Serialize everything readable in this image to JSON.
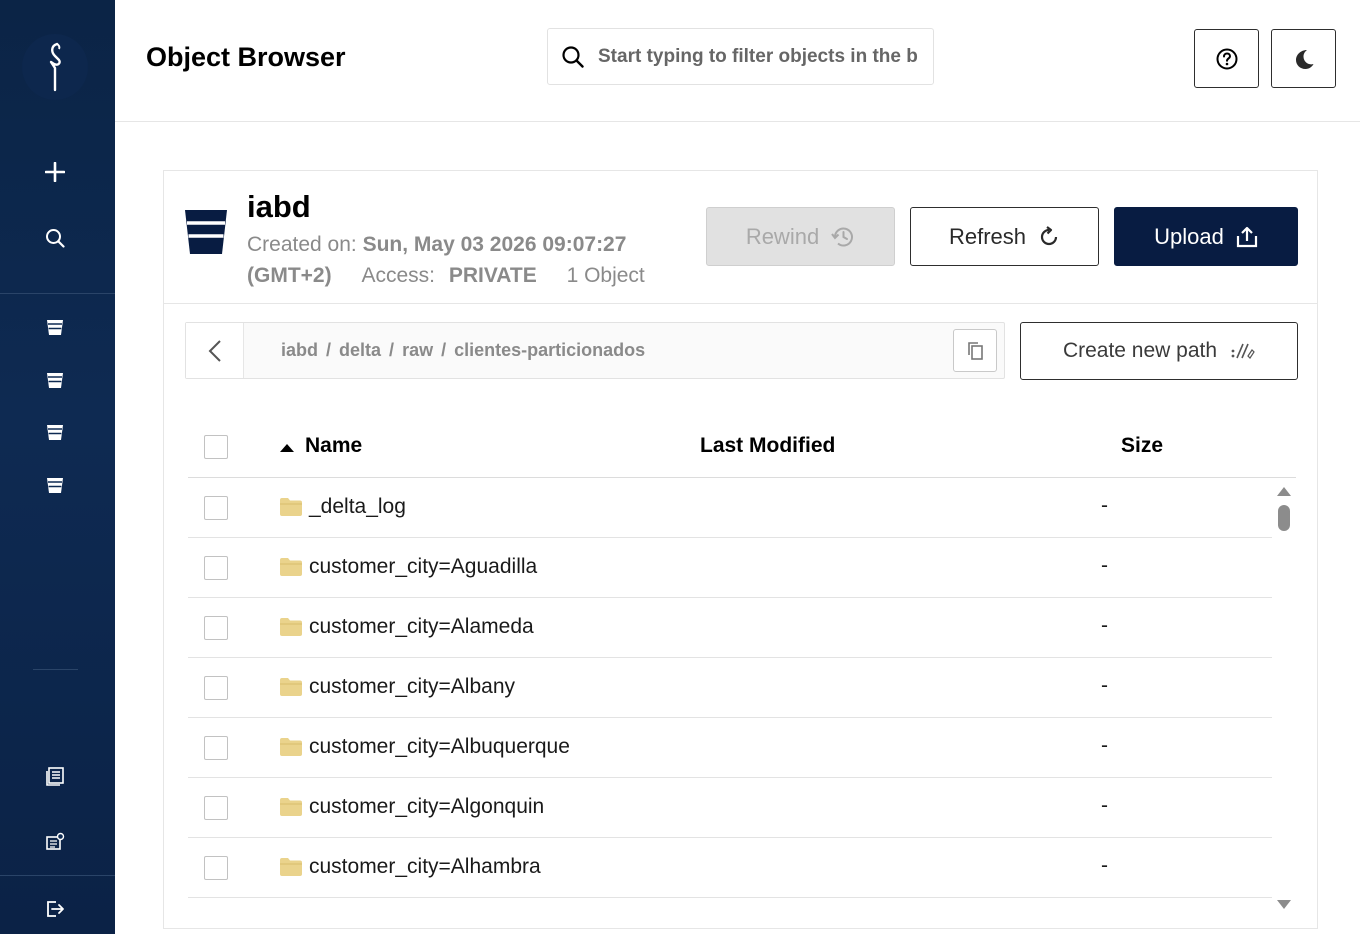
{
  "app": {
    "title": "Object Browser"
  },
  "search": {
    "placeholder": "Start typing to filter objects in the bucket"
  },
  "header_buttons": {
    "help_icon": "help-circle-icon",
    "theme_icon": "moon-icon"
  },
  "sidebar": {
    "logo_icon": "minio-bird-icon",
    "items": [
      {
        "icon": "plus-icon"
      },
      {
        "icon": "search-icon"
      },
      {
        "icon": "bucket-icon"
      },
      {
        "icon": "bucket-icon"
      },
      {
        "icon": "bucket-icon"
      },
      {
        "icon": "bucket-icon"
      },
      {
        "icon": "docs-icon"
      },
      {
        "icon": "license-icon"
      },
      {
        "icon": "logout-icon"
      }
    ]
  },
  "bucket": {
    "name": "iabd",
    "created_label": "Created on:",
    "created_value": "Sun, May 03 2026 09:07:27",
    "timezone": "(GMT+2)",
    "access_label": "Access:",
    "access_value": "PRIVATE",
    "objects": "1 Object"
  },
  "actions": {
    "rewind": "Rewind",
    "refresh": "Refresh",
    "upload": "Upload",
    "create_path": "Create new path"
  },
  "path": {
    "segments": [
      "iabd",
      "delta",
      "raw",
      "clientes-particionados"
    ],
    "separator": "/"
  },
  "table": {
    "columns": {
      "name": "Name",
      "modified": "Last Modified",
      "size": "Size"
    },
    "sort_icon": "sort-ascending-icon",
    "rows": [
      {
        "name": "_delta_log",
        "modified": "",
        "size": "-"
      },
      {
        "name": "customer_city=Aguadilla",
        "modified": "",
        "size": "-"
      },
      {
        "name": "customer_city=Alameda",
        "modified": "",
        "size": "-"
      },
      {
        "name": "customer_city=Albany",
        "modified": "",
        "size": "-"
      },
      {
        "name": "customer_city=Albuquerque",
        "modified": "",
        "size": "-"
      },
      {
        "name": "customer_city=Algonquin",
        "modified": "",
        "size": "-"
      },
      {
        "name": "customer_city=Alhambra",
        "modified": "",
        "size": "-"
      }
    ]
  },
  "colors": {
    "sidebar": "#0b2446",
    "primary": "#081c42",
    "folder": "#ead38c",
    "muted_text": "#8a8a8a"
  }
}
